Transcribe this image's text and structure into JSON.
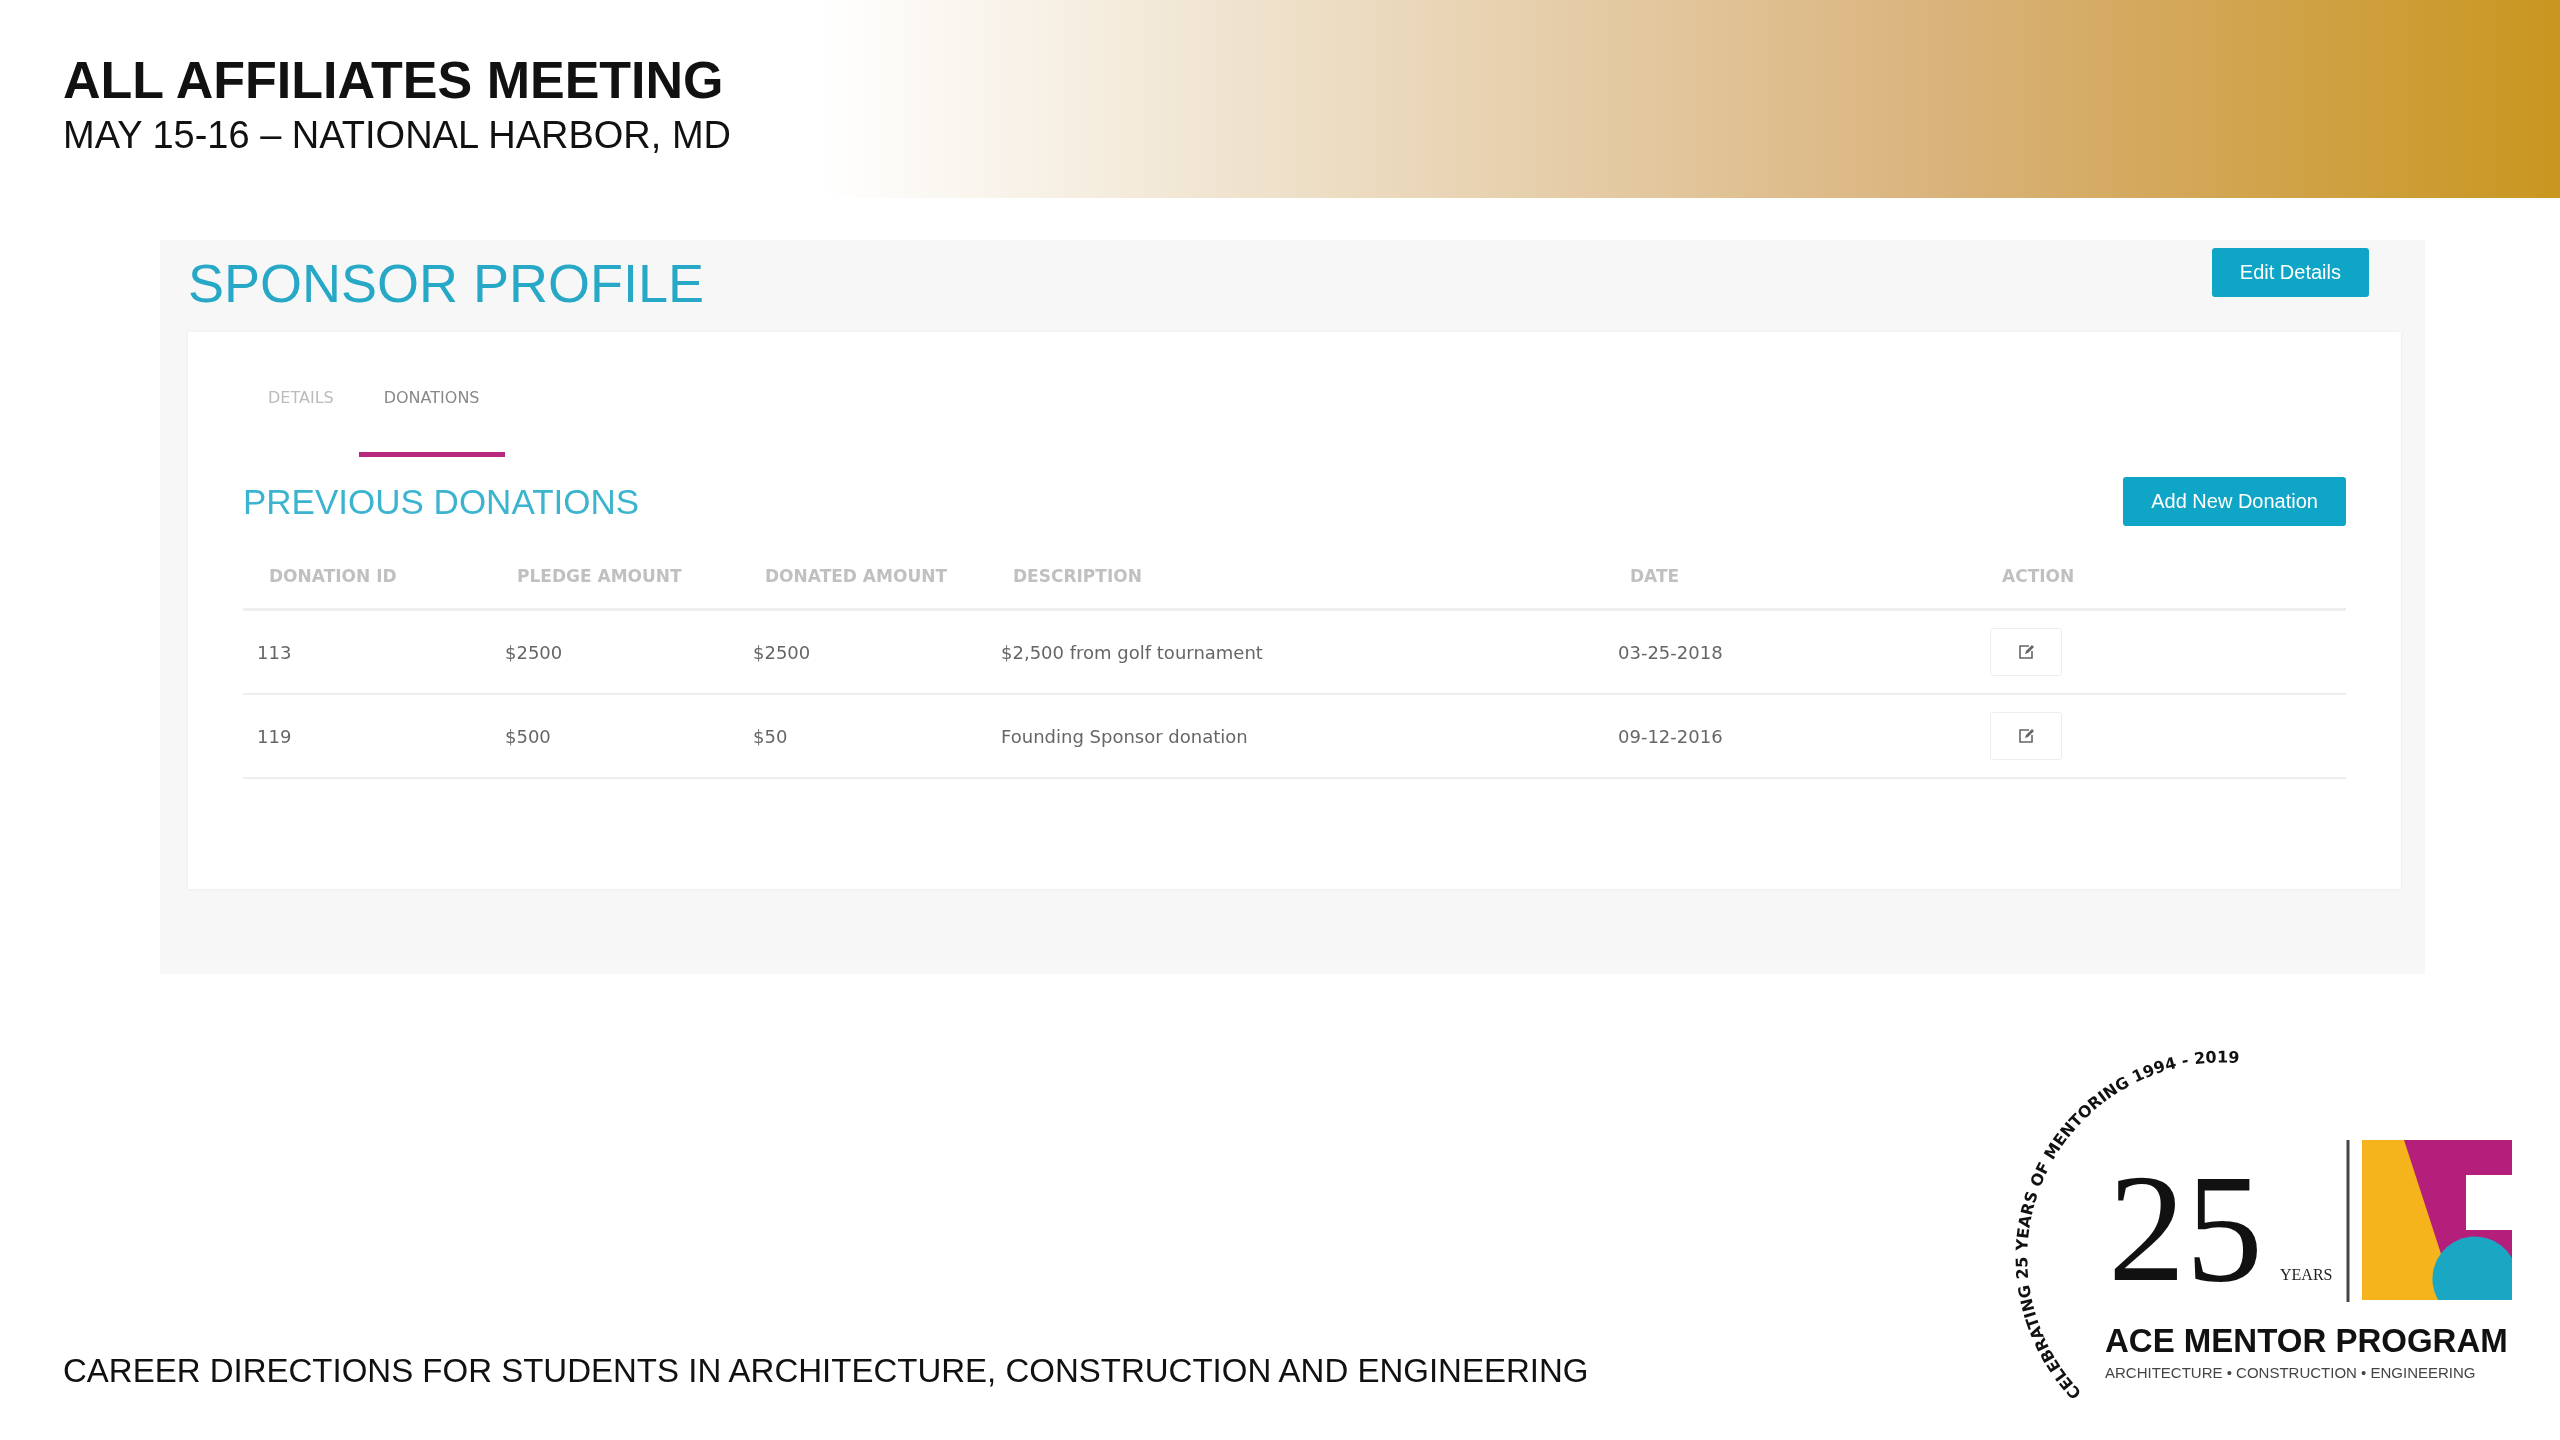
{
  "slide": {
    "title": "ALL AFFILIATES MEETING",
    "subtitle": "MAY 15-16 – NATIONAL HARBOR, MD",
    "footer": "CAREER DIRECTIONS FOR STUDENTS IN ARCHITECTURE, CONSTRUCTION AND ENGINEERING"
  },
  "page": {
    "title": "SPONSOR PROFILE",
    "edit_button": "Edit Details"
  },
  "tabs": [
    {
      "label": "DETAILS",
      "selected": false
    },
    {
      "label": "DONATIONS",
      "selected": true
    }
  ],
  "section": {
    "title": "PREVIOUS DONATIONS",
    "add_button": "Add New Donation"
  },
  "table": {
    "columns": [
      "DONATION ID",
      "PLEDGE AMOUNT",
      "DONATED AMOUNT",
      "DESCRIPTION",
      "DATE",
      "ACTION"
    ],
    "rows": [
      {
        "id": "113",
        "pledge": "$2500",
        "donated": "$2500",
        "description": "$2,500 from golf tournament",
        "date": "03-25-2018"
      },
      {
        "id": "119",
        "pledge": "$500",
        "donated": "$50",
        "description": "Founding Sponsor donation",
        "date": "09-12-2016"
      }
    ]
  },
  "logo": {
    "arc": "CELEBRATING 25 YEARS OF MENTORING 1994 - 2019",
    "number": "25",
    "unit": "YEARS",
    "name": "ACE MENTOR PROGRAM",
    "tagline": "ARCHITECTURE • CONSTRUCTION • ENGINEERING"
  }
}
